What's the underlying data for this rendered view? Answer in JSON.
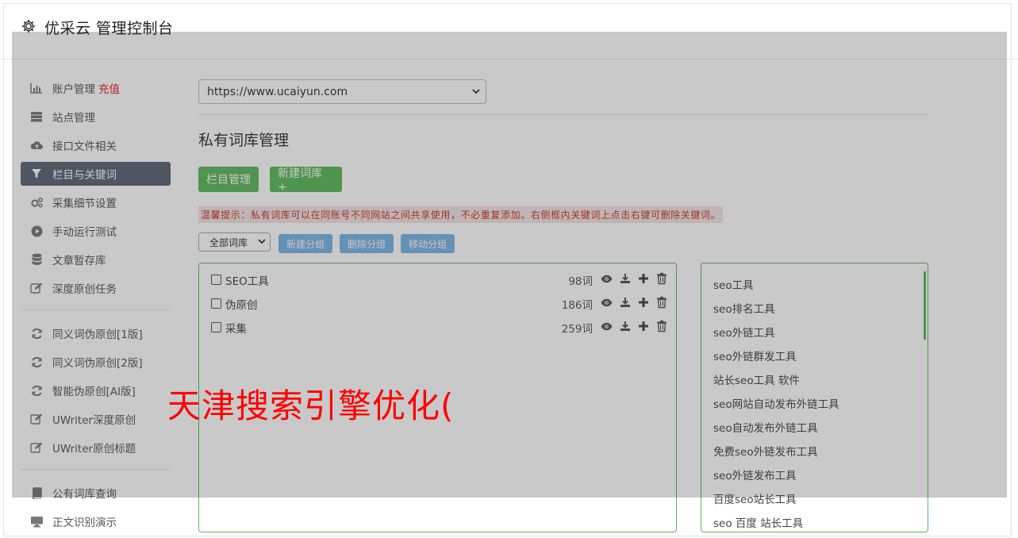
{
  "header": {
    "title": "优采云 管理控制台"
  },
  "sidebar": {
    "items": [
      {
        "label": "账户管理",
        "extra": "充值",
        "icon": "bar-chart-icon"
      },
      {
        "label": "站点管理",
        "icon": "server-icon"
      },
      {
        "label": "接口文件相关",
        "icon": "cloud-upload-icon"
      },
      {
        "label": "栏目与关键词",
        "icon": "filter-icon",
        "active": true
      },
      {
        "label": "采集细节设置",
        "icon": "cogs-icon"
      },
      {
        "label": "手动运行测试",
        "icon": "play-icon"
      },
      {
        "label": "文章暂存库",
        "icon": "database-icon"
      },
      {
        "label": "深度原创任务",
        "icon": "edit-icon"
      },
      {
        "label": "同义词伪原创[1版]",
        "icon": "refresh-icon"
      },
      {
        "label": "同义词伪原创[2版]",
        "icon": "refresh-icon"
      },
      {
        "label": "智能伪原创[AI版]",
        "icon": "refresh-icon"
      },
      {
        "label": "UWriter深度原创",
        "icon": "edit-icon"
      },
      {
        "label": "UWriter原创标题",
        "icon": "edit-icon"
      },
      {
        "label": "公有词库查询",
        "icon": "book-icon"
      },
      {
        "label": "正文识别演示",
        "icon": "monitor-icon"
      }
    ]
  },
  "main": {
    "site_select": "https://www.ucaiyun.com",
    "page_title": "私有词库管理",
    "btn_columns": "栏目管理",
    "btn_new_lib": "新建词库 +",
    "tip": "温馨提示：私有词库可以在同账号不同网站之间共享使用，不必重复添加。右侧框内关键词上点击右键可删除关键词。",
    "group_select": "全部词库",
    "btn_new_group": "新建分组",
    "btn_delete_group": "删除分组",
    "btn_move_group": "移动分组",
    "libraries": [
      {
        "name": "SEO工具",
        "count": "98词"
      },
      {
        "name": "伪原创",
        "count": "186词"
      },
      {
        "name": "采集",
        "count": "259词"
      }
    ],
    "keywords": [
      "seo工具",
      "seo排名工具",
      "seo外链工具",
      "seo外链群发工具",
      "站长seo工具 软件",
      "seo网站自动发布外链工具",
      "seo自动发布外链工具",
      "免费seo外链发布工具",
      "seo外链发布工具",
      "百度seo站长工具",
      "seo 百度 站长工具"
    ]
  },
  "watermark": "天津搜索引擎优化(",
  "colors": {
    "accent_green": "#5cb85c",
    "accent_blue": "#7cb3e6",
    "active_nav": "#5b6477",
    "recharge_red": "#e02020",
    "watermark_red": "#ff0000"
  }
}
